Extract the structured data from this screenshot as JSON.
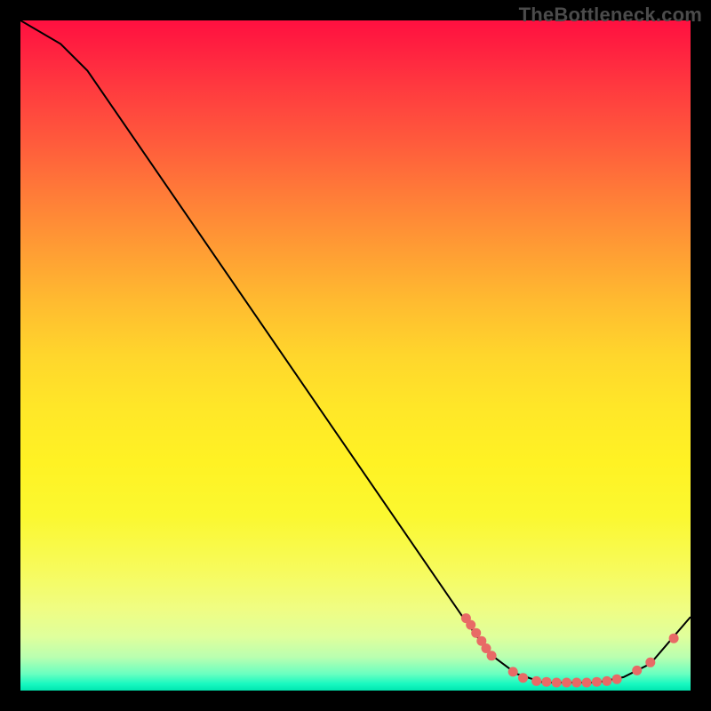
{
  "watermark": "TheBottleneck.com",
  "colors": {
    "marker_fill": "#e86a66",
    "line_stroke": "#000000"
  },
  "chart_data": {
    "type": "line",
    "title": "",
    "xlabel": "",
    "ylabel": "",
    "xlim": [
      0,
      100
    ],
    "ylim": [
      0,
      100
    ],
    "grid": false,
    "line_points": [
      {
        "x": 0,
        "y": 100.0
      },
      {
        "x": 6,
        "y": 96.5
      },
      {
        "x": 10,
        "y": 92.5
      },
      {
        "x": 66,
        "y": 11.0
      },
      {
        "x": 70,
        "y": 5.5
      },
      {
        "x": 74,
        "y": 2.5
      },
      {
        "x": 78,
        "y": 1.2
      },
      {
        "x": 82,
        "y": 1.2
      },
      {
        "x": 86,
        "y": 1.2
      },
      {
        "x": 90,
        "y": 2.0
      },
      {
        "x": 94,
        "y": 4.0
      },
      {
        "x": 100,
        "y": 11.0
      }
    ],
    "markers": [
      {
        "x": 66.5,
        "y": 10.8
      },
      {
        "x": 67.2,
        "y": 9.8
      },
      {
        "x": 68.0,
        "y": 8.6
      },
      {
        "x": 68.8,
        "y": 7.4
      },
      {
        "x": 69.5,
        "y": 6.3
      },
      {
        "x": 70.3,
        "y": 5.2
      },
      {
        "x": 73.5,
        "y": 2.8
      },
      {
        "x": 75.0,
        "y": 1.9
      },
      {
        "x": 77.0,
        "y": 1.4
      },
      {
        "x": 78.5,
        "y": 1.3
      },
      {
        "x": 80.0,
        "y": 1.2
      },
      {
        "x": 81.5,
        "y": 1.2
      },
      {
        "x": 83.0,
        "y": 1.2
      },
      {
        "x": 84.5,
        "y": 1.2
      },
      {
        "x": 86.0,
        "y": 1.3
      },
      {
        "x": 87.5,
        "y": 1.4
      },
      {
        "x": 89.0,
        "y": 1.7
      },
      {
        "x": 92.0,
        "y": 3.0
      },
      {
        "x": 94.0,
        "y": 4.2
      },
      {
        "x": 97.5,
        "y": 7.8
      }
    ]
  }
}
